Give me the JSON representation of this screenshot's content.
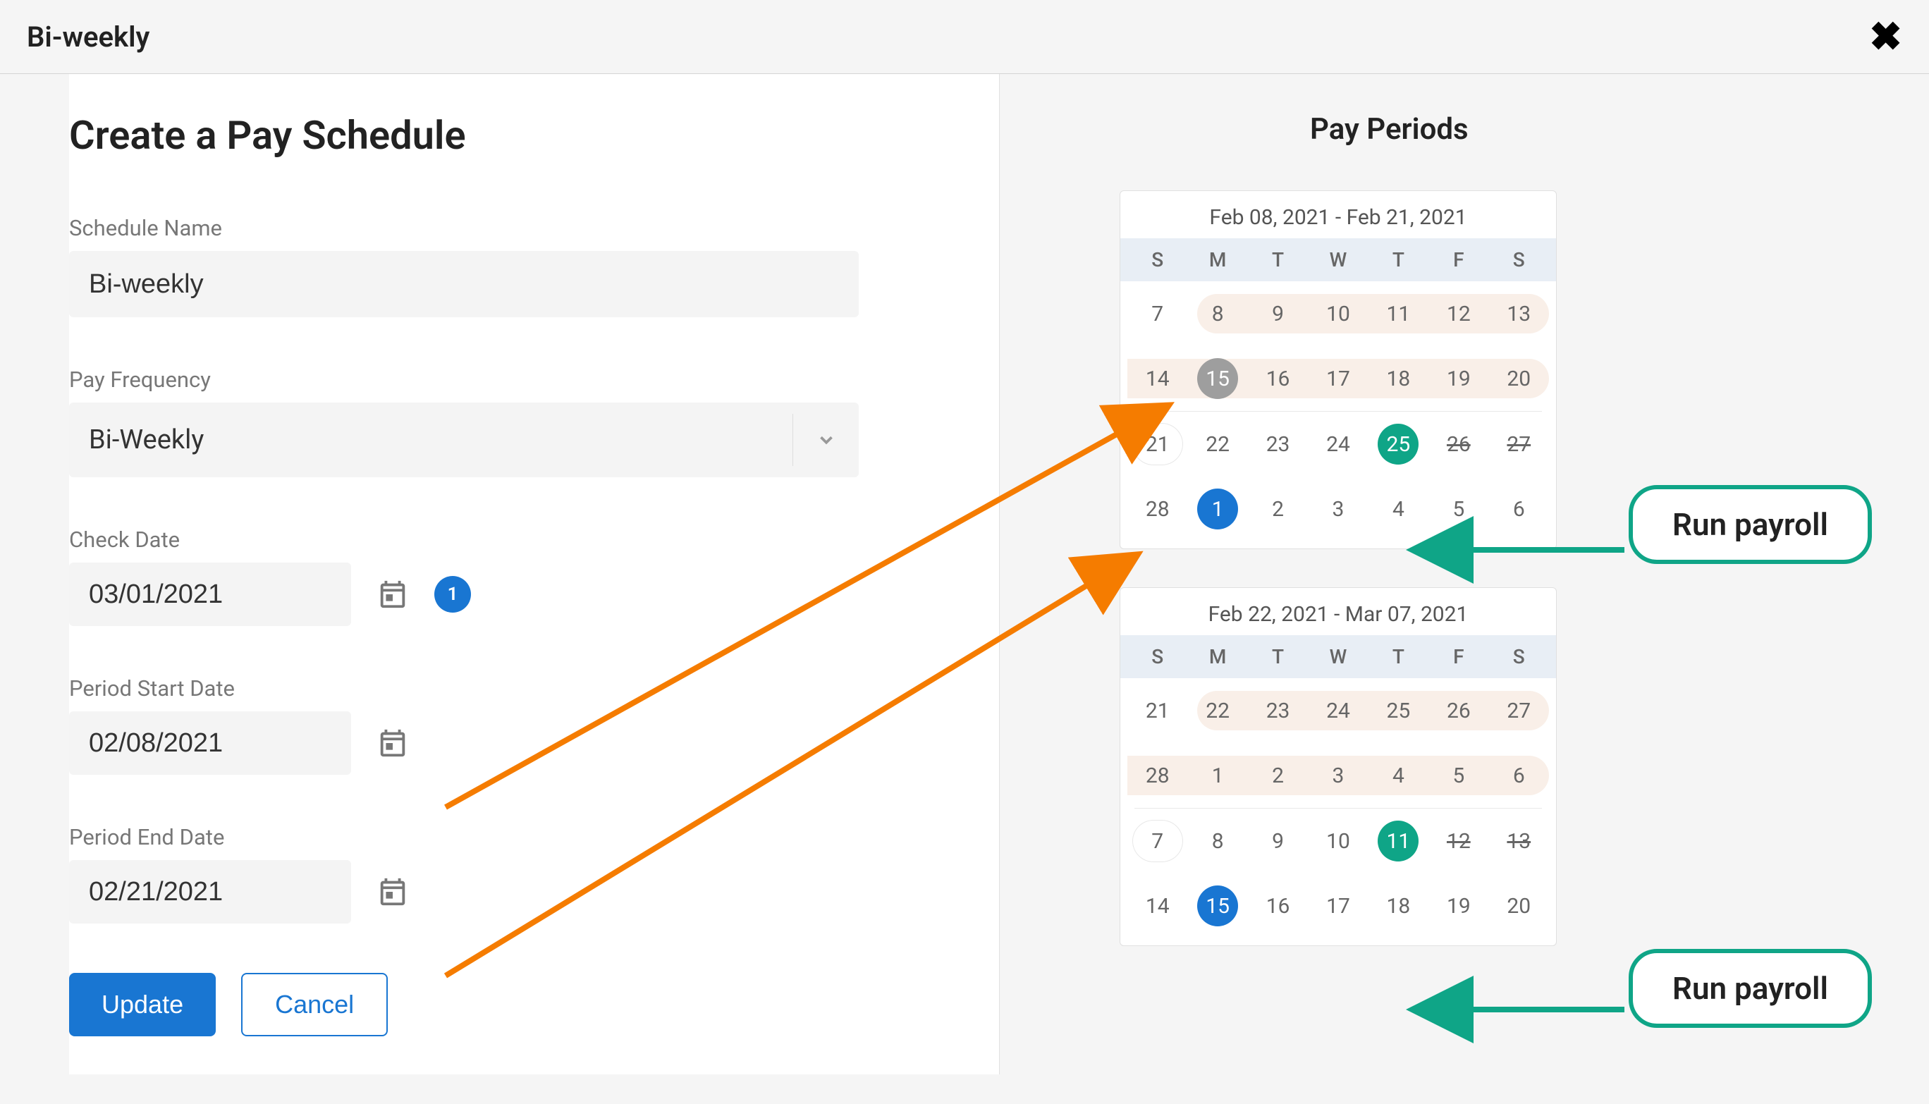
{
  "header": {
    "title": "Bi-weekly"
  },
  "form": {
    "page_title": "Create a Pay Schedule",
    "schedule_name_label": "Schedule Name",
    "schedule_name_value": "Bi-weekly",
    "pay_frequency_label": "Pay Frequency",
    "pay_frequency_value": "Bi-Weekly",
    "check_date_label": "Check Date",
    "check_date_value": "03/01/2021",
    "check_date_badge": "1",
    "period_start_label": "Period Start Date",
    "period_start_value": "02/08/2021",
    "period_end_label": "Period End Date",
    "period_end_value": "02/21/2021",
    "update_label": "Update",
    "cancel_label": "Cancel"
  },
  "right": {
    "title": "Pay Periods",
    "weekdays": [
      "S",
      "M",
      "T",
      "W",
      "T",
      "F",
      "S"
    ],
    "calendars": [
      {
        "title": "Feb 08, 2021 - Feb 21, 2021",
        "rows": [
          {
            "period": false,
            "cells": [
              {
                "d": "7",
                "style": "plain"
              },
              {
                "d": "8",
                "style": "period-start"
              },
              {
                "d": "9",
                "style": "period"
              },
              {
                "d": "10",
                "style": "period"
              },
              {
                "d": "11",
                "style": "period"
              },
              {
                "d": "12",
                "style": "period"
              },
              {
                "d": "13",
                "style": "period"
              }
            ]
          },
          {
            "period": false,
            "cells": [
              {
                "d": "14",
                "style": "period"
              },
              {
                "d": "15",
                "style": "gray"
              },
              {
                "d": "16",
                "style": "period"
              },
              {
                "d": "17",
                "style": "period"
              },
              {
                "d": "18",
                "style": "period"
              },
              {
                "d": "19",
                "style": "period"
              },
              {
                "d": "20",
                "style": "period"
              }
            ]
          },
          {
            "period": false,
            "cells": [
              {
                "d": "21",
                "style": "pill"
              },
              {
                "d": "22",
                "style": "plain"
              },
              {
                "d": "23",
                "style": "plain"
              },
              {
                "d": "24",
                "style": "plain"
              },
              {
                "d": "25",
                "style": "green"
              },
              {
                "d": "26",
                "style": "strike"
              },
              {
                "d": "27",
                "style": "strike"
              }
            ]
          },
          {
            "period": false,
            "cells": [
              {
                "d": "28",
                "style": "plain"
              },
              {
                "d": "1",
                "style": "blue"
              },
              {
                "d": "2",
                "style": "plain"
              },
              {
                "d": "3",
                "style": "plain"
              },
              {
                "d": "4",
                "style": "plain"
              },
              {
                "d": "5",
                "style": "plain"
              },
              {
                "d": "6",
                "style": "plain"
              }
            ]
          }
        ]
      },
      {
        "title": "Feb 22, 2021 - Mar 07, 2021",
        "rows": [
          {
            "period": false,
            "cells": [
              {
                "d": "21",
                "style": "plain"
              },
              {
                "d": "22",
                "style": "period-start"
              },
              {
                "d": "23",
                "style": "period"
              },
              {
                "d": "24",
                "style": "period"
              },
              {
                "d": "25",
                "style": "period"
              },
              {
                "d": "26",
                "style": "period"
              },
              {
                "d": "27",
                "style": "period"
              }
            ]
          },
          {
            "period": false,
            "cells": [
              {
                "d": "28",
                "style": "period"
              },
              {
                "d": "1",
                "style": "period"
              },
              {
                "d": "2",
                "style": "period"
              },
              {
                "d": "3",
                "style": "period"
              },
              {
                "d": "4",
                "style": "period"
              },
              {
                "d": "5",
                "style": "period"
              },
              {
                "d": "6",
                "style": "period"
              }
            ]
          },
          {
            "period": false,
            "cells": [
              {
                "d": "7",
                "style": "pill"
              },
              {
                "d": "8",
                "style": "plain"
              },
              {
                "d": "9",
                "style": "plain"
              },
              {
                "d": "10",
                "style": "plain"
              },
              {
                "d": "11",
                "style": "green"
              },
              {
                "d": "12",
                "style": "strike"
              },
              {
                "d": "13",
                "style": "strike"
              }
            ]
          },
          {
            "period": false,
            "cells": [
              {
                "d": "14",
                "style": "plain"
              },
              {
                "d": "15",
                "style": "blue"
              },
              {
                "d": "16",
                "style": "plain"
              },
              {
                "d": "17",
                "style": "plain"
              },
              {
                "d": "18",
                "style": "plain"
              },
              {
                "d": "19",
                "style": "plain"
              },
              {
                "d": "20",
                "style": "plain"
              }
            ]
          }
        ]
      }
    ]
  },
  "annotations": {
    "run_payroll_1": "Run payroll",
    "run_payroll_2": "Run payroll"
  }
}
